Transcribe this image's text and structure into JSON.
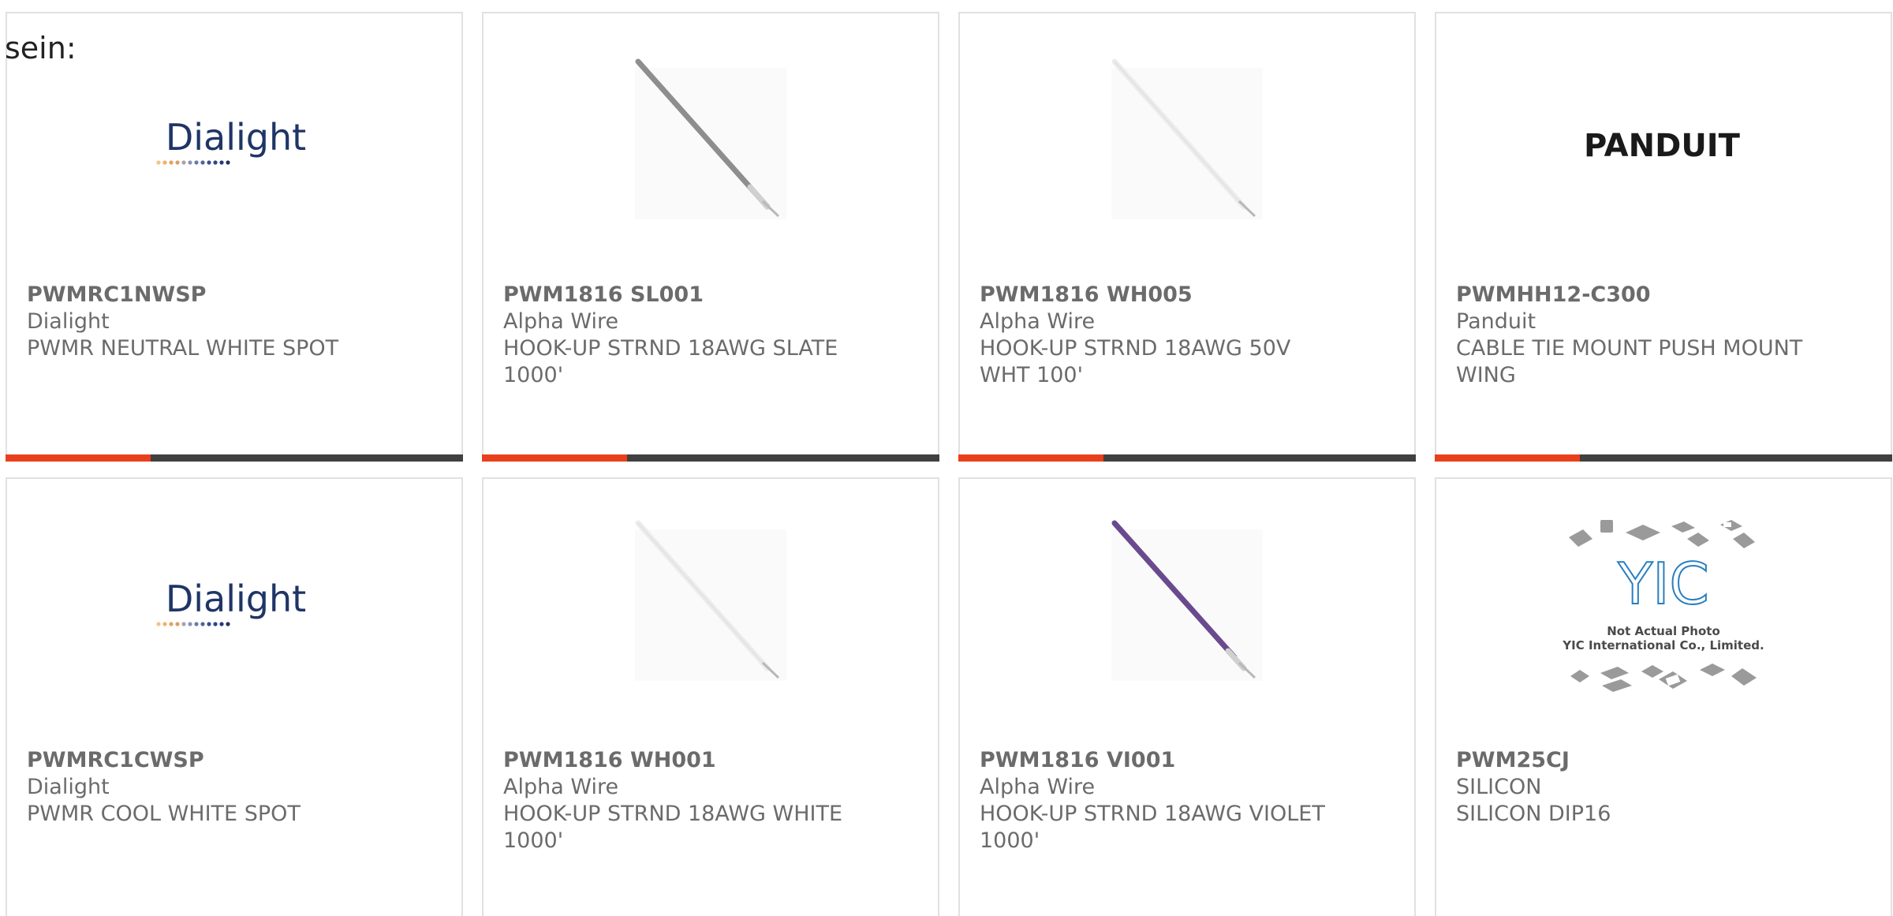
{
  "lead_text": "sein:",
  "colors": {
    "accent": "#e8401c",
    "bar_dark": "#404040",
    "text": "#6b6b6b",
    "dialight_blue": "#1f3566",
    "violet_wire": "#6a4a8f"
  },
  "products": [
    {
      "part": "PWMRC1NWSP",
      "brand": "Dialight",
      "desc": "PWMR NEUTRAL WHITE SPOT",
      "image": "dialight-logo",
      "logo_text": "Dialight"
    },
    {
      "part": "PWM1816 SL001",
      "brand": "Alpha Wire",
      "desc": "HOOK-UP STRND 18AWG SLATE 1000'",
      "image": "wire-slate"
    },
    {
      "part": "PWM1816 WH005",
      "brand": "Alpha Wire",
      "desc": "HOOK-UP STRND 18AWG 50V WHT 100'",
      "image": "wire-white"
    },
    {
      "part": "PWMHH12-C300",
      "brand": "Panduit",
      "desc": "CABLE TIE MOUNT PUSH MOUNT WING",
      "image": "panduit-logo",
      "logo_text": "PANDUIT"
    },
    {
      "part": "PWMRC1CWSP",
      "brand": "Dialight",
      "desc": "PWMR COOL WHITE SPOT",
      "image": "dialight-logo",
      "logo_text": "Dialight"
    },
    {
      "part": "PWM1816 WH001",
      "brand": "Alpha Wire",
      "desc": "HOOK-UP STRND 18AWG WHITE 1000'",
      "image": "wire-white"
    },
    {
      "part": "PWM1816 VI001",
      "brand": "Alpha Wire",
      "desc": "HOOK-UP STRND 18AWG VIOLET 1000'",
      "image": "wire-violet"
    },
    {
      "part": "PWM25CJ",
      "brand": "SILICON",
      "desc": "SILICON DIP16",
      "image": "yic-placeholder",
      "logo_text": "YIC",
      "photo_note_1": "Not Actual Photo",
      "photo_note_2": "YIC International Co., Limited."
    }
  ]
}
